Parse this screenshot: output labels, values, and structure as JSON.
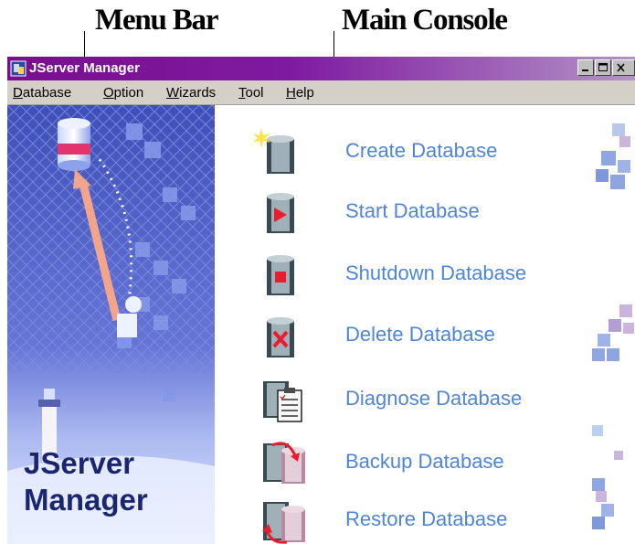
{
  "annotations": {
    "menu_bar": "Menu Bar",
    "main_console": "Main Console"
  },
  "window": {
    "title": "JServer Manager",
    "controls": [
      "minimize-icon",
      "maximize-icon",
      "close-icon"
    ]
  },
  "menu": {
    "items": [
      {
        "mnemonic": "D",
        "rest": "atabase"
      },
      {
        "mnemonic": "O",
        "rest": "ption"
      },
      {
        "mnemonic": "W",
        "rest": "izards"
      },
      {
        "mnemonic": "T",
        "rest": "ool"
      },
      {
        "mnemonic": "H",
        "rest": "elp"
      }
    ]
  },
  "brand": {
    "line1": "JServer",
    "line2": "Manager"
  },
  "console": {
    "items": [
      {
        "label": "Create Database",
        "icon": "create-database-icon"
      },
      {
        "label": "Start Database",
        "icon": "start-database-icon"
      },
      {
        "label": "Shutdown Database",
        "icon": "shutdown-database-icon"
      },
      {
        "label": "Delete Database",
        "icon": "delete-database-icon"
      },
      {
        "label": "Diagnose Database",
        "icon": "diagnose-database-icon"
      },
      {
        "label": "Backup Database",
        "icon": "backup-database-icon"
      },
      {
        "label": "Restore Database",
        "icon": "restore-database-icon"
      }
    ]
  },
  "colors": {
    "title_gradient_start": "#7a0e8e",
    "title_gradient_end": "#b392c6",
    "menubar_bg": "#d4d0c8",
    "console_label": "#4f85d8",
    "panel_bg": "#4c5fc2"
  }
}
